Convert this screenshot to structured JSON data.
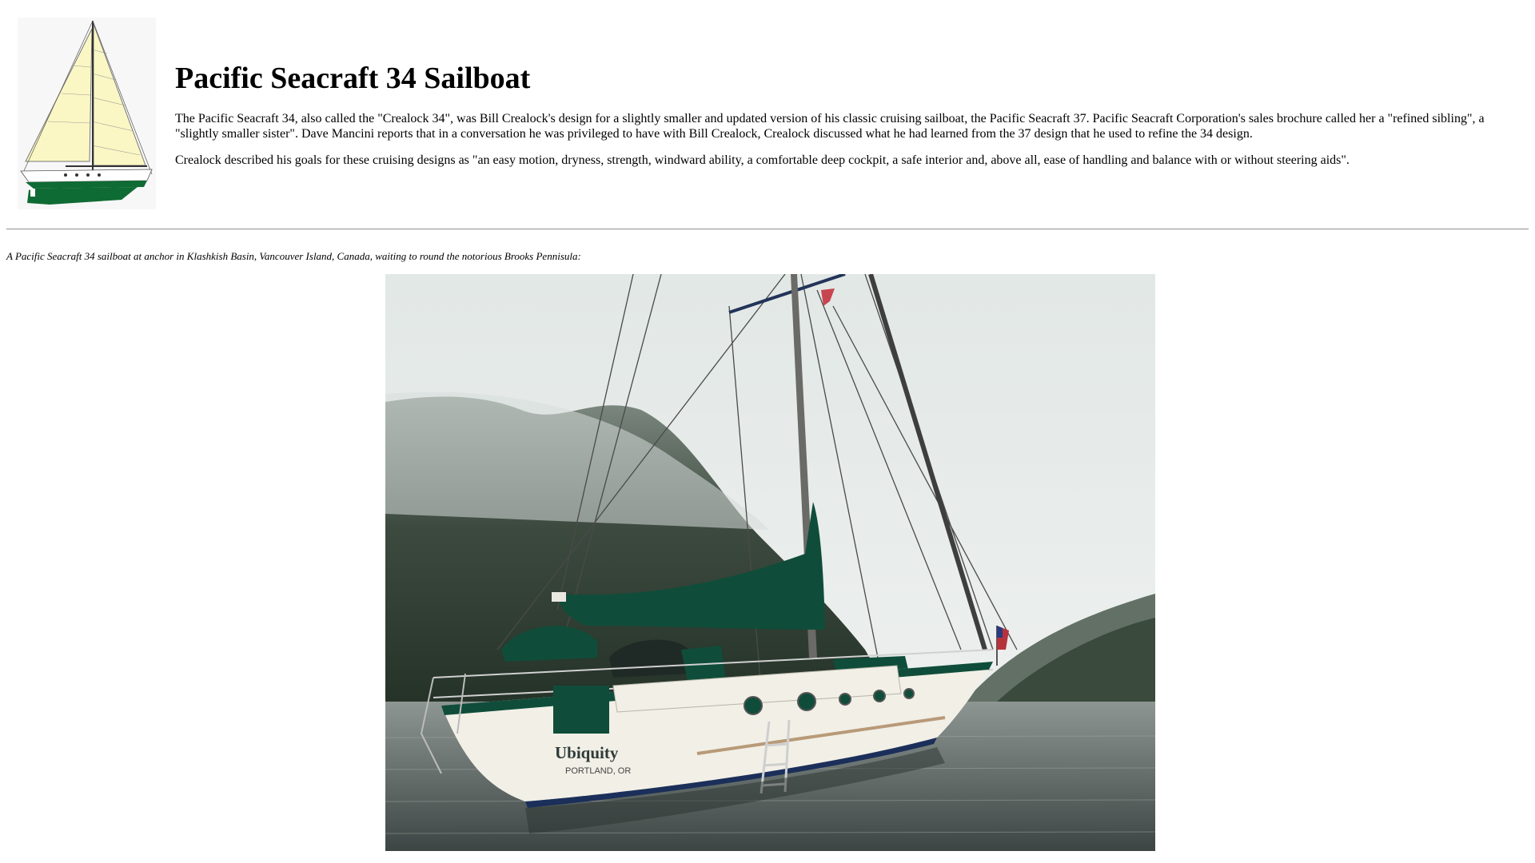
{
  "page": {
    "title": "Pacific Seacraft 34 Sailboat",
    "paragraphs": [
      "The Pacific Seacraft 34, also called the \"Crealock 34\", was Bill Crealock's design for a slightly smaller and updated version of his classic cruising sailboat, the Pacific Seacraft 37. Pacific Seacraft Corporation's sales brochure called her a \"refined sibling\", a \"slightly smaller sister\". Dave Mancini reports that in a conversation he was privileged to have with Bill Crealock, Crealock discussed what he had learned from the 37 design that he used to refine the 34 design.",
      "Crealock described his goals for these cruising designs as \"an easy motion, dryness, strength, windward ability, a comfortable deep cockpit, a safe interior and, above all, ease of handling and balance with or without steering aids\"."
    ],
    "caption": "A Pacific Seacraft 34 sailboat at anchor in Klashkish Basin, Vancouver Island, Canada, waiting to round the notorious Brooks Pennisula:"
  },
  "images": {
    "thumbnail": {
      "alt_icon": "sailboat-drawing-icon",
      "colors": {
        "sail": "#fbf7c4",
        "hull": "#0f6b34",
        "mast": "#333333"
      }
    },
    "photo": {
      "boat_name": "Ubiquity",
      "boat_port": "PORTLAND, OR",
      "colors": {
        "sky": "#e9ecea",
        "forest": "#2f3e30",
        "water": "#5b6461",
        "hull": "#f1efe6",
        "canvas": "#0f4d3a"
      }
    }
  }
}
